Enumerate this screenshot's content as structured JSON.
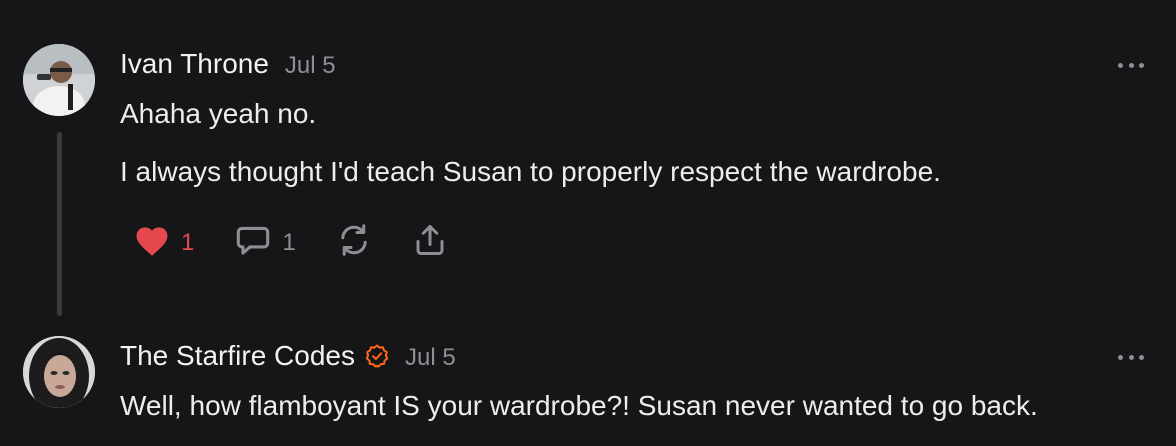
{
  "comments": [
    {
      "author": "Ivan Throne",
      "date": "Jul 5",
      "verified": false,
      "paragraphs": [
        "Ahaha yeah no.",
        "I always thought I'd teach Susan to properly respect the wardrobe."
      ],
      "actions": {
        "like_count": "1",
        "liked": true,
        "reply_count": "1"
      }
    },
    {
      "author": "The Starfire Codes",
      "date": "Jul 5",
      "verified": true,
      "paragraphs": [
        "Well, how flamboyant IS your wardrobe?! Susan never wanted to go back."
      ]
    }
  ],
  "colors": {
    "background": "#161618",
    "like": "#e5484d",
    "verified": "#ff6719",
    "muted": "#8e8e93"
  },
  "icons": {
    "like": "heart-icon",
    "reply": "comment-bubble-icon",
    "restack": "restack-icon",
    "share": "share-icon",
    "more": "more-dots-icon",
    "verified": "verified-badge-icon"
  }
}
